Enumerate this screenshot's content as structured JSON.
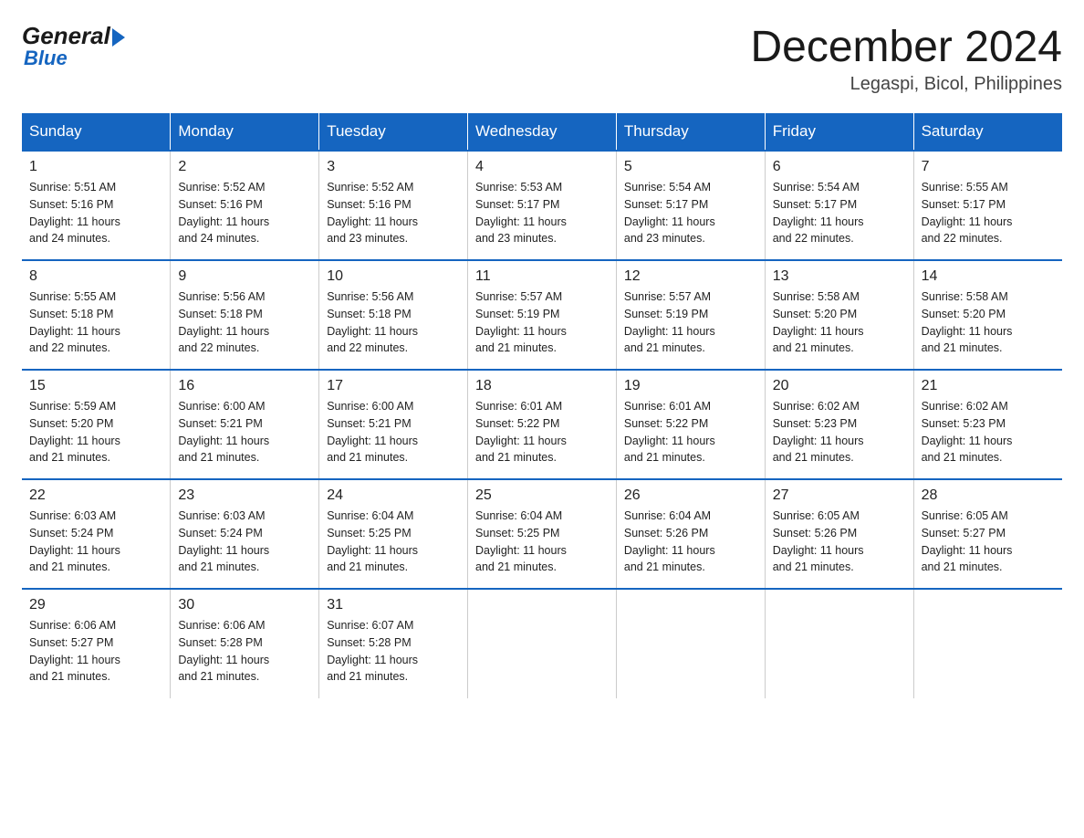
{
  "logo": {
    "general": "General",
    "blue": "Blue"
  },
  "title": "December 2024",
  "location": "Legaspi, Bicol, Philippines",
  "days_of_week": [
    "Sunday",
    "Monday",
    "Tuesday",
    "Wednesday",
    "Thursday",
    "Friday",
    "Saturday"
  ],
  "weeks": [
    [
      {
        "day": "1",
        "sunrise": "5:51 AM",
        "sunset": "5:16 PM",
        "daylight": "11 hours and 24 minutes."
      },
      {
        "day": "2",
        "sunrise": "5:52 AM",
        "sunset": "5:16 PM",
        "daylight": "11 hours and 24 minutes."
      },
      {
        "day": "3",
        "sunrise": "5:52 AM",
        "sunset": "5:16 PM",
        "daylight": "11 hours and 23 minutes."
      },
      {
        "day": "4",
        "sunrise": "5:53 AM",
        "sunset": "5:17 PM",
        "daylight": "11 hours and 23 minutes."
      },
      {
        "day": "5",
        "sunrise": "5:54 AM",
        "sunset": "5:17 PM",
        "daylight": "11 hours and 23 minutes."
      },
      {
        "day": "6",
        "sunrise": "5:54 AM",
        "sunset": "5:17 PM",
        "daylight": "11 hours and 22 minutes."
      },
      {
        "day": "7",
        "sunrise": "5:55 AM",
        "sunset": "5:17 PM",
        "daylight": "11 hours and 22 minutes."
      }
    ],
    [
      {
        "day": "8",
        "sunrise": "5:55 AM",
        "sunset": "5:18 PM",
        "daylight": "11 hours and 22 minutes."
      },
      {
        "day": "9",
        "sunrise": "5:56 AM",
        "sunset": "5:18 PM",
        "daylight": "11 hours and 22 minutes."
      },
      {
        "day": "10",
        "sunrise": "5:56 AM",
        "sunset": "5:18 PM",
        "daylight": "11 hours and 22 minutes."
      },
      {
        "day": "11",
        "sunrise": "5:57 AM",
        "sunset": "5:19 PM",
        "daylight": "11 hours and 21 minutes."
      },
      {
        "day": "12",
        "sunrise": "5:57 AM",
        "sunset": "5:19 PM",
        "daylight": "11 hours and 21 minutes."
      },
      {
        "day": "13",
        "sunrise": "5:58 AM",
        "sunset": "5:20 PM",
        "daylight": "11 hours and 21 minutes."
      },
      {
        "day": "14",
        "sunrise": "5:58 AM",
        "sunset": "5:20 PM",
        "daylight": "11 hours and 21 minutes."
      }
    ],
    [
      {
        "day": "15",
        "sunrise": "5:59 AM",
        "sunset": "5:20 PM",
        "daylight": "11 hours and 21 minutes."
      },
      {
        "day": "16",
        "sunrise": "6:00 AM",
        "sunset": "5:21 PM",
        "daylight": "11 hours and 21 minutes."
      },
      {
        "day": "17",
        "sunrise": "6:00 AM",
        "sunset": "5:21 PM",
        "daylight": "11 hours and 21 minutes."
      },
      {
        "day": "18",
        "sunrise": "6:01 AM",
        "sunset": "5:22 PM",
        "daylight": "11 hours and 21 minutes."
      },
      {
        "day": "19",
        "sunrise": "6:01 AM",
        "sunset": "5:22 PM",
        "daylight": "11 hours and 21 minutes."
      },
      {
        "day": "20",
        "sunrise": "6:02 AM",
        "sunset": "5:23 PM",
        "daylight": "11 hours and 21 minutes."
      },
      {
        "day": "21",
        "sunrise": "6:02 AM",
        "sunset": "5:23 PM",
        "daylight": "11 hours and 21 minutes."
      }
    ],
    [
      {
        "day": "22",
        "sunrise": "6:03 AM",
        "sunset": "5:24 PM",
        "daylight": "11 hours and 21 minutes."
      },
      {
        "day": "23",
        "sunrise": "6:03 AM",
        "sunset": "5:24 PM",
        "daylight": "11 hours and 21 minutes."
      },
      {
        "day": "24",
        "sunrise": "6:04 AM",
        "sunset": "5:25 PM",
        "daylight": "11 hours and 21 minutes."
      },
      {
        "day": "25",
        "sunrise": "6:04 AM",
        "sunset": "5:25 PM",
        "daylight": "11 hours and 21 minutes."
      },
      {
        "day": "26",
        "sunrise": "6:04 AM",
        "sunset": "5:26 PM",
        "daylight": "11 hours and 21 minutes."
      },
      {
        "day": "27",
        "sunrise": "6:05 AM",
        "sunset": "5:26 PM",
        "daylight": "11 hours and 21 minutes."
      },
      {
        "day": "28",
        "sunrise": "6:05 AM",
        "sunset": "5:27 PM",
        "daylight": "11 hours and 21 minutes."
      }
    ],
    [
      {
        "day": "29",
        "sunrise": "6:06 AM",
        "sunset": "5:27 PM",
        "daylight": "11 hours and 21 minutes."
      },
      {
        "day": "30",
        "sunrise": "6:06 AM",
        "sunset": "5:28 PM",
        "daylight": "11 hours and 21 minutes."
      },
      {
        "day": "31",
        "sunrise": "6:07 AM",
        "sunset": "5:28 PM",
        "daylight": "11 hours and 21 minutes."
      },
      null,
      null,
      null,
      null
    ]
  ],
  "labels": {
    "sunrise": "Sunrise:",
    "sunset": "Sunset:",
    "daylight": "Daylight:"
  }
}
